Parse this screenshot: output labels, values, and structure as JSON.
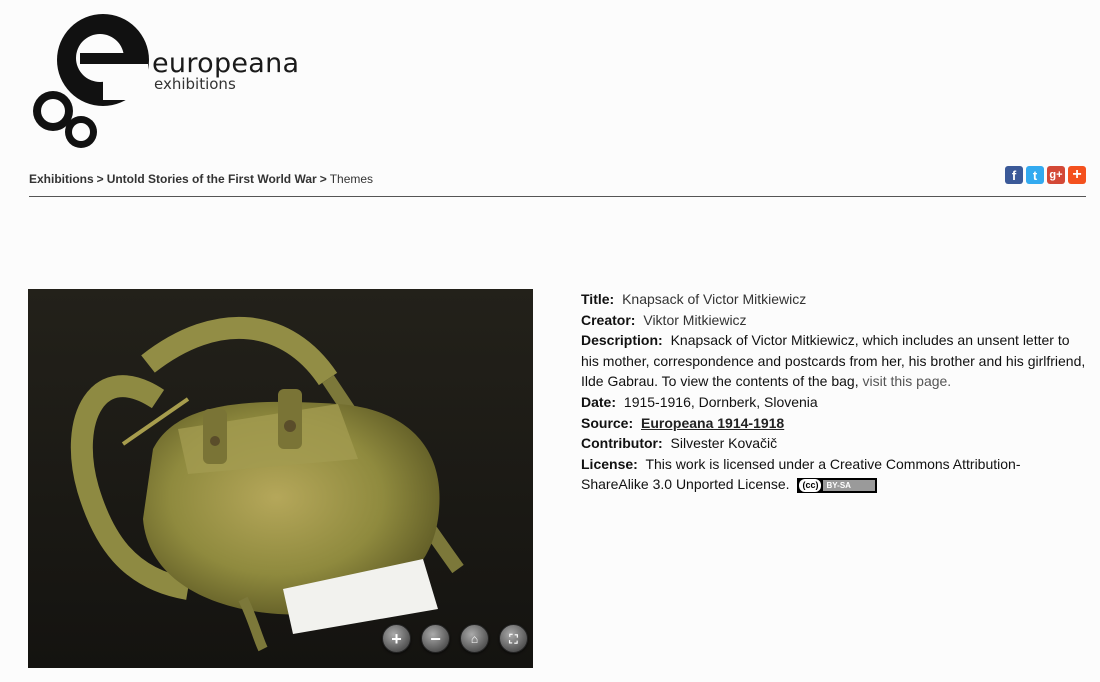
{
  "brand": {
    "name": "europeana",
    "tagline": "exhibitions",
    "logo_icon": "europeana-logo-icon"
  },
  "breadcrumb": {
    "items": [
      "Exhibitions",
      "Untold Stories of the First World War"
    ],
    "current": "Themes",
    "separator": ">"
  },
  "social": [
    {
      "name": "facebook-icon",
      "glyph": "f"
    },
    {
      "name": "twitter-icon",
      "glyph": "t"
    },
    {
      "name": "google-plus-icon",
      "glyph": "g+"
    },
    {
      "name": "addthis-icon",
      "glyph": "+"
    }
  ],
  "viewer": {
    "controls": [
      {
        "name": "zoom-in-button",
        "icon": "plus-icon",
        "glyph": "+"
      },
      {
        "name": "zoom-out-button",
        "icon": "minus-icon",
        "glyph": "−"
      },
      {
        "name": "home-button",
        "icon": "home-icon",
        "glyph": "⌂"
      },
      {
        "name": "fullscreen-button",
        "icon": "fullscreen-icon",
        "glyph": "⛶"
      }
    ]
  },
  "meta": {
    "title_label": "Title:",
    "title": "Knapsack of Victor Mitkiewicz",
    "creator_label": "Creator:",
    "creator": "Viktor Mitkiewicz",
    "description_label": "Description:",
    "description": "Knapsack of Victor Mitkiewicz, which includes an unsent letter to his mother, correspondence and postcards from her, his brother and his girlfriend, Ilde Gabrau. To view the contents of the bag,",
    "description_link": "visit this page.",
    "date_label": "Date:",
    "date": "1915-1916, Dornberk, Slovenia",
    "source_label": "Source:",
    "source": "Europeana 1914-1918",
    "contributor_label": "Contributor:",
    "contributor": "Silvester Kovačič",
    "license_label": "License:",
    "license": "This work is licensed under a Creative Commons Attribution-ShareAlike 3.0 Unported License.",
    "license_badge": {
      "left": "(cc)",
      "right": "BY-SA"
    }
  }
}
